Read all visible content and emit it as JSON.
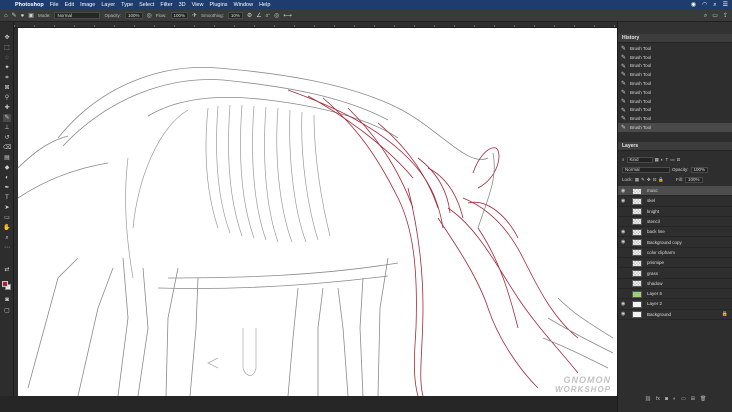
{
  "menubar": {
    "apple_icon": "apple-icon",
    "app_name": "Photoshop",
    "items": [
      "File",
      "Edit",
      "Image",
      "Layer",
      "Type",
      "Select",
      "Filter",
      "3D",
      "View",
      "Plugins",
      "Window",
      "Help"
    ],
    "status_icons": [
      "screen-record-icon",
      "wifi-icon",
      "search-icon",
      "control-center-icon"
    ]
  },
  "options_bar": {
    "mode_label": "Mode:",
    "mode_value": "Normal",
    "opacity_label": "Opacity:",
    "opacity_value": "100%",
    "flow_label": "Flow:",
    "flow_value": "100%",
    "smoothing_label": "Smoothing:",
    "smoothing_value": "10%",
    "angle_value": "0°"
  },
  "history": {
    "title": "History",
    "items": [
      "Brush Tool",
      "Brush Tool",
      "Brush Tool",
      "Brush Tool",
      "Brush Tool",
      "Brush Tool",
      "Brush Tool",
      "Brush Tool",
      "Brush Tool",
      "Brush Tool"
    ],
    "current_index": 9
  },
  "layers": {
    "title": "Layers",
    "filter_label": "Kind",
    "blend_mode": "Normal",
    "opacity_label": "Opacity:",
    "opacity_value": "100%",
    "lock_label": "Lock:",
    "fill_label": "Fill:",
    "fill_value": "100%",
    "items": [
      {
        "name": "musc",
        "visible": true,
        "locked": false,
        "selected": true
      },
      {
        "name": "skel",
        "visible": true,
        "locked": false,
        "selected": false
      },
      {
        "name": "knight",
        "visible": false,
        "locked": false,
        "selected": false
      },
      {
        "name": "stencil",
        "visible": false,
        "locked": false,
        "selected": false
      },
      {
        "name": "back line",
        "visible": true,
        "locked": false,
        "selected": false
      },
      {
        "name": "Background copy",
        "visible": true,
        "locked": false,
        "selected": false
      },
      {
        "name": "color clipharm",
        "visible": false,
        "locked": false,
        "selected": false
      },
      {
        "name": "prismipe",
        "visible": false,
        "locked": false,
        "selected": false
      },
      {
        "name": "grass",
        "visible": false,
        "locked": false,
        "selected": false
      },
      {
        "name": "shadow",
        "visible": false,
        "locked": false,
        "selected": false
      },
      {
        "name": "Layer 6",
        "visible": false,
        "locked": false,
        "selected": false
      },
      {
        "name": "Layer 2",
        "visible": true,
        "locked": false,
        "selected": false
      },
      {
        "name": "Background",
        "visible": true,
        "locked": true,
        "selected": false
      }
    ]
  },
  "watermark": {
    "line1": "GNOMON",
    "line2": "WORKSHOP"
  },
  "colors": {
    "foreground": "#a8213a",
    "background": "#e8e8e8",
    "muscle_stroke": "#a3283c",
    "sketch_stroke": "#8a8a8a"
  }
}
